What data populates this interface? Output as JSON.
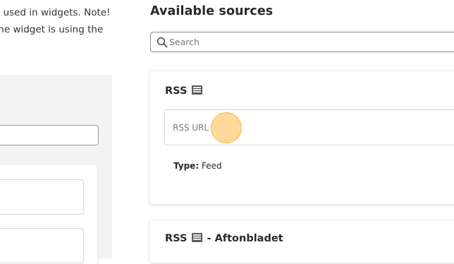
{
  "intro": {
    "line1": "e used in widgets. Note!",
    "line2": "the widget is using the"
  },
  "available": {
    "heading": "Available sources",
    "search_placeholder": "Search"
  },
  "sources": [
    {
      "title_prefix": "RSS",
      "icon": "newspaper-icon",
      "title_suffix": "",
      "url_placeholder": "RSS URL",
      "type_label": "Type:",
      "type_value": "Feed"
    },
    {
      "title_prefix": "RSS",
      "icon": "newspaper-icon",
      "title_suffix": " - Aftonbladet"
    }
  ]
}
